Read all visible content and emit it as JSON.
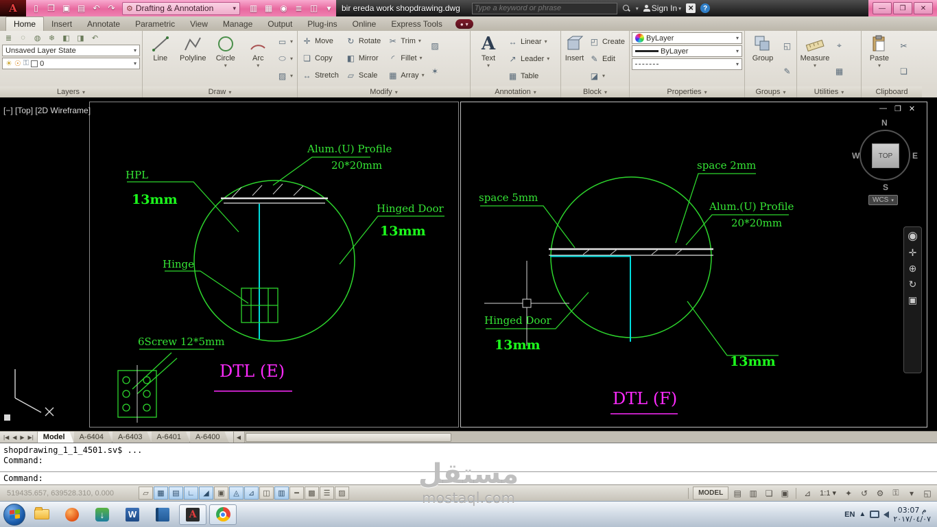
{
  "titlebar": {
    "workspace": "Drafting & Annotation",
    "doc_title": "bir ereda work shopdrawing.dwg",
    "search_placeholder": "Type a keyword or phrase",
    "sign_in_label": "Sign In"
  },
  "icons": {
    "dropdown": "▾",
    "minimize": "—",
    "maximize": "❐",
    "close": "✕",
    "undo": "↶",
    "redo": "↷",
    "help": "?",
    "overflow_dot": "●",
    "first_tab": "|◀",
    "prev_tab": "◀",
    "next_tab": "▶",
    "last_tab": "▶|",
    "tray_expand": "▲",
    "autocad_letter": "A",
    "word_letter": "W",
    "text_tool_letter": "A",
    "idm_arrow": "↓"
  },
  "ribbon_tabs": {
    "items": [
      "Home",
      "Insert",
      "Annotate",
      "Parametric",
      "View",
      "Manage",
      "Output",
      "Plug-ins",
      "Online",
      "Express Tools"
    ],
    "active": "Home"
  },
  "ribbon": {
    "layers": {
      "label": "Layers",
      "state_value": "Unsaved Layer State",
      "layer_value": "0"
    },
    "draw": {
      "label": "Draw",
      "line": "Line",
      "polyline": "Polyline",
      "circle": "Circle",
      "arc": "Arc"
    },
    "modify": {
      "label": "Modify",
      "move": "Move",
      "rotate": "Rotate",
      "trim": "Trim",
      "copy": "Copy",
      "mirror": "Mirror",
      "fillet": "Fillet",
      "stretch": "Stretch",
      "scale": "Scale",
      "array": "Array"
    },
    "annotation": {
      "label": "Annotation",
      "text": "Text",
      "linear": "Linear",
      "leader": "Leader",
      "table": "Table"
    },
    "block": {
      "label": "Block",
      "insert": "Insert",
      "create": "Create",
      "edit": "Edit"
    },
    "properties": {
      "label": "Properties",
      "color_value": "ByLayer",
      "lineweight_value": "ByLayer"
    },
    "groups": {
      "label": "Groups",
      "group": "Group"
    },
    "utilities": {
      "label": "Utilities",
      "measure": "Measure"
    },
    "clipboard": {
      "label": "Clipboard",
      "paste": "Paste"
    }
  },
  "drawing": {
    "viewport_controls": "[−] [Top] [2D Wireframe]",
    "viewcube": {
      "north": "N",
      "west": "W",
      "east": "E",
      "south": "S",
      "top": "TOP",
      "wcs": "WCS"
    },
    "details": {
      "left": {
        "hpl": "HPL",
        "hpl_size": "13mm",
        "profile": "Alum.(U) Profile",
        "profile_size": "20*20mm",
        "hinged_door": "Hinged Door",
        "hinged_door_size": "13mm",
        "hinge": "Hinge",
        "screw": "6Screw 12*5mm",
        "title": "DTL (E)"
      },
      "right": {
        "space_top": "space 2mm",
        "space_left": "space 5mm",
        "profile": "Alum.(U) Profile",
        "profile_size": "20*20mm",
        "hinged_door": "Hinged Door",
        "hinged_door_size": "13mm",
        "size_right": "13mm",
        "title": "DTL (F)"
      }
    }
  },
  "layout_tabs": {
    "tabs": [
      "Model",
      "A-6404",
      "A-6403",
      "A-6401",
      "A-6400"
    ],
    "active": "Model"
  },
  "command_line": {
    "history": [
      "shopdrawing_1_1_4501.sv$ ...",
      "Command:"
    ],
    "prompt": "Command:"
  },
  "status_bar": {
    "coordinates": "519435.657, 639528.310, 0.000",
    "model_label": "MODEL",
    "annotation_scale": "1:1"
  },
  "taskbar": {
    "language": "EN",
    "time": "03:07 م",
    "date": "٢٠١٧/٠٤/٠٧"
  },
  "watermark": {
    "name": "مستقل",
    "site": "mostaql.com"
  },
  "colors": {
    "cad_green": "#2dd62d",
    "cad_bright_green": "#1dff1d",
    "cad_magenta": "#ff2bff",
    "cad_cyan": "#00dcdc",
    "titlebar_pink": "#ee86ba",
    "drawing_background": "#000000"
  }
}
